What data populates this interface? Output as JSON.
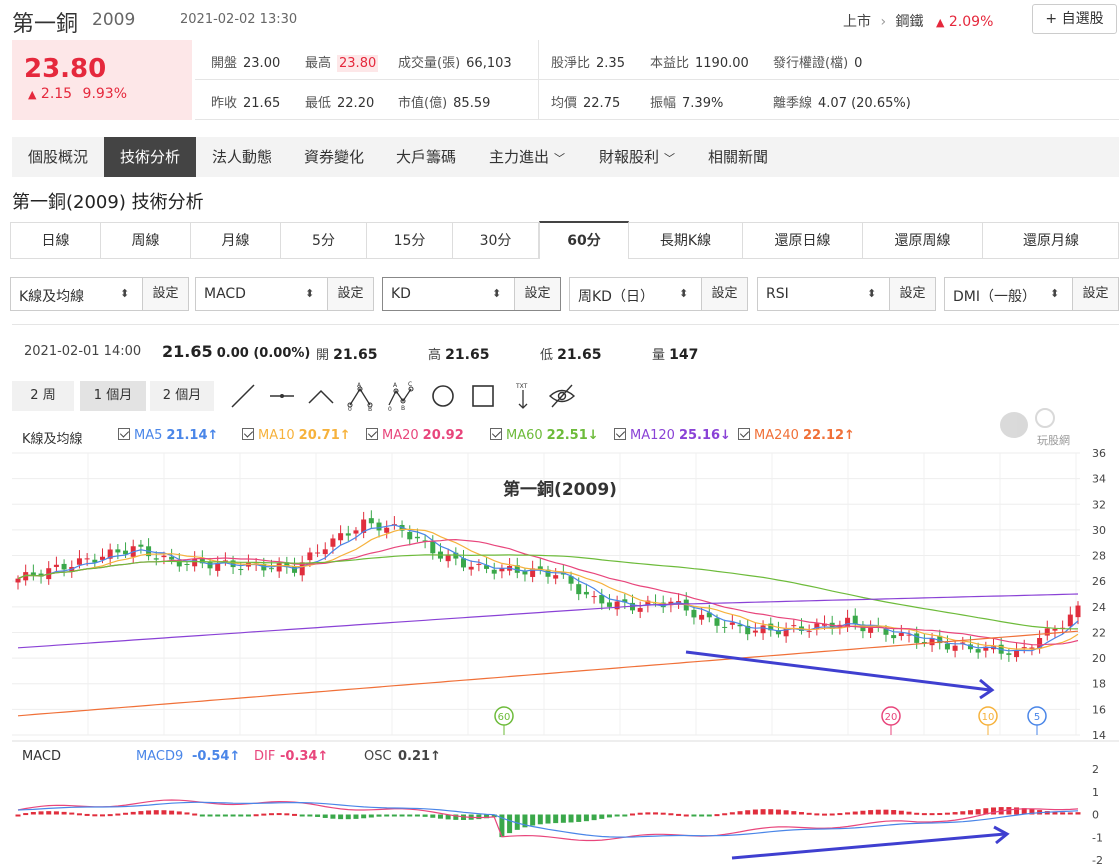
{
  "header": {
    "name": "第一銅",
    "code": "2009",
    "datetime": "2021-02-02 13:30",
    "market": "上市",
    "industry": "鋼鐵",
    "change_pct": "2.09%",
    "watch_label": "+ 自選股"
  },
  "quote": {
    "price": "23.80",
    "change": "2.15",
    "change_pct": "9.93%",
    "rows": [
      [
        {
          "k": "開盤",
          "v": "23.00"
        },
        {
          "k": "最高",
          "v": "23.80"
        },
        {
          "k": "成交量(張)",
          "v": "66,103"
        },
        {
          "k": "股淨比",
          "v": "2.35"
        },
        {
          "k": "本益比",
          "v": "1190.00"
        },
        {
          "k": "發行權證(檔)",
          "v": "0"
        }
      ],
      [
        {
          "k": "昨收",
          "v": "21.65"
        },
        {
          "k": "最低",
          "v": "22.20"
        },
        {
          "k": "市值(億)",
          "v": "85.59"
        },
        {
          "k": "均價",
          "v": "22.75"
        },
        {
          "k": "振幅",
          "v": "7.39%"
        },
        {
          "k": "離季線",
          "v": "4.07 (20.65%)"
        }
      ]
    ]
  },
  "tabs": [
    "個股概況",
    "技術分析",
    "法人動態",
    "資券變化",
    "大戶籌碼",
    "主力進出",
    "財報股利",
    "相關新聞"
  ],
  "tabs_active": 1,
  "subtitle": "第一銅(2009) 技術分析",
  "periods": [
    "日線",
    "周線",
    "月線",
    "5分",
    "15分",
    "30分",
    "60分",
    "長期K線",
    "還原日線",
    "還原周線",
    "還原月線"
  ],
  "period_active": 6,
  "selectors": [
    {
      "label": "K線及均線",
      "btn": "設定"
    },
    {
      "label": "MACD",
      "btn": "設定"
    },
    {
      "label": "KD",
      "btn": "設定"
    },
    {
      "label": "周KD（日）",
      "btn": "設定"
    },
    {
      "label": "RSI",
      "btn": "設定"
    },
    {
      "label": "DMI（一般）",
      "btn": "設定"
    }
  ],
  "info": {
    "datetime": "2021-02-01 14:00",
    "close": "21.65",
    "change": "0.00 (0.00%)",
    "open_label": "開",
    "open": "21.65",
    "high_label": "高",
    "high": "21.65",
    "low_label": "低",
    "low": "21.65",
    "vol_label": "量",
    "vol": "147"
  },
  "ranges": [
    "2 周",
    "1 個月",
    "2 個月"
  ],
  "range_active": 1,
  "tools": [
    "line-icon",
    "horizontal-line-icon",
    "angle-icon",
    "abc-pattern-icon",
    "abcd-pattern-icon",
    "circle-icon",
    "rectangle-icon",
    "text-icon",
    "hide-icon"
  ],
  "legend": {
    "title": "K線及均線",
    "items": [
      {
        "name": "MA5",
        "value": "21.14↑",
        "color": "#4a86e8"
      },
      {
        "name": "MA10",
        "value": "20.71↑",
        "color": "#f6b23c"
      },
      {
        "name": "MA20",
        "value": "20.92",
        "color": "#e8467c"
      },
      {
        "name": "MA60",
        "value": "22.51↓",
        "color": "#6dbb3a"
      },
      {
        "name": "MA120",
        "value": "25.16↓",
        "color": "#8a42d6"
      },
      {
        "name": "MA240",
        "value": "22.12↑",
        "color": "#f07038"
      }
    ]
  },
  "watermark": "玩股網",
  "chart_data": [
    {
      "type": "candlestick",
      "title": "第一銅(2009)",
      "ylim": [
        14,
        36
      ],
      "yticks": [
        "36",
        "34",
        "32",
        "30",
        "28",
        "26",
        "24",
        "22",
        "20",
        "18",
        "16",
        "14"
      ],
      "ma_markers": [
        {
          "label": "60",
          "color": "#6dbb3a"
        },
        {
          "label": "20",
          "color": "#e8467c"
        },
        {
          "label": "10",
          "color": "#f6b23c"
        },
        {
          "label": "5",
          "color": "#4a86e8"
        }
      ]
    },
    {
      "type": "macd",
      "title": "MACD",
      "ylim": [
        -2,
        2
      ],
      "yticks": [
        "2",
        "1",
        "0",
        "-1",
        "-2"
      ],
      "legend": [
        {
          "name": "MACD9",
          "value": "-0.54↑",
          "color": "#4a86e8"
        },
        {
          "name": "DIF",
          "value": "-0.34↑",
          "color": "#e8467c"
        },
        {
          "name": "OSC",
          "value": "0.21↑",
          "color": "#444"
        }
      ]
    }
  ]
}
